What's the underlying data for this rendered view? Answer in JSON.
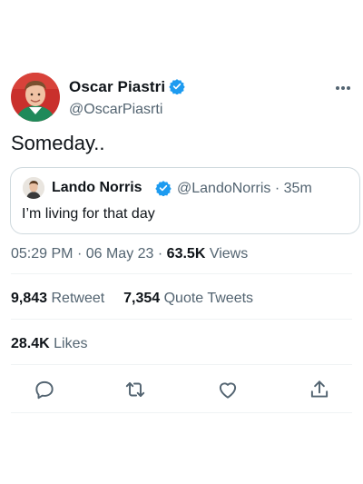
{
  "tweet": {
    "author": {
      "name": "Oscar Piastri",
      "handle": "@OscarPiasrti",
      "verified": true
    },
    "text": "Someday..",
    "quoted": {
      "name": "Lando Norris",
      "handle": "@LandoNorris",
      "separator": "·",
      "time_ago": "35m",
      "text": "I’m living for that day"
    },
    "meta": {
      "time": "05:29 PM",
      "separator1": "·",
      "date": "06 May 23",
      "separator2": "·",
      "views_count": "63.5K",
      "views_label": "Views"
    },
    "stats": {
      "retweets_count": "9,843",
      "retweets_label": "Retweet",
      "quotes_count": "7,354",
      "quotes_label": "Quote Tweets",
      "likes_count": "28.4K",
      "likes_label": "Likes"
    },
    "actions": [
      "reply-icon",
      "retweet-icon",
      "like-icon",
      "share-icon"
    ],
    "colors": {
      "verified": "#1d9bf0",
      "muted": "#536471",
      "text": "#0f1419",
      "border": "#cfd9de"
    }
  }
}
